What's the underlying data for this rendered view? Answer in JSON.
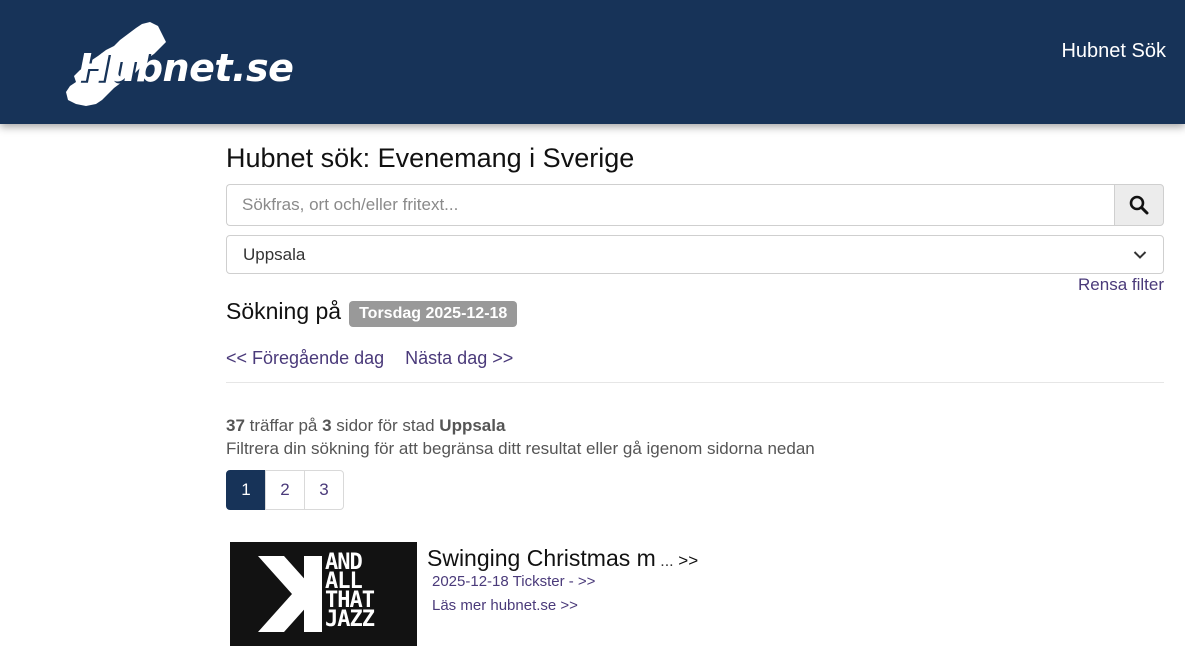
{
  "header": {
    "logo_text": "Hubnet.se",
    "nav_link": "Hubnet Sök"
  },
  "page": {
    "title": "Hubnet sök: Evenemang i Sverige"
  },
  "search": {
    "placeholder": "Sökfras, ort och/eller fritext...",
    "value": "",
    "button_icon": "search-icon"
  },
  "filter": {
    "city_selected": "Uppsala",
    "clear_label": "Rensa filter"
  },
  "date": {
    "label": "Sökning på",
    "badge": "Torsdag 2025-12-18",
    "prev": "<< Föregående dag",
    "next": "Nästa dag >>"
  },
  "results": {
    "count": "37",
    "count_text": " träffar på ",
    "pages": "3",
    "pages_text": " sidor för stad ",
    "city": "Uppsala",
    "hint": "Filtrera din sökning för att begränsa ditt resultat eller gå igenom sidorna nedan"
  },
  "pagination": {
    "items": [
      "1",
      "2",
      "3"
    ],
    "active": "1"
  },
  "events": [
    {
      "image_text": [
        "AND",
        "ALL",
        "THAT",
        "JAZZ"
      ],
      "title": "Swinging Christmas m",
      "ellipsis": " ...",
      "more_link": " >>",
      "date_source": "2025-12-18 Tickster - >>",
      "read_more": "Läs mer hubnet.se >>"
    }
  ],
  "colors": {
    "header_bg": "#173358",
    "link": "#4a3a7a",
    "badge_bg": "#999999",
    "active_page_bg": "#173358"
  }
}
